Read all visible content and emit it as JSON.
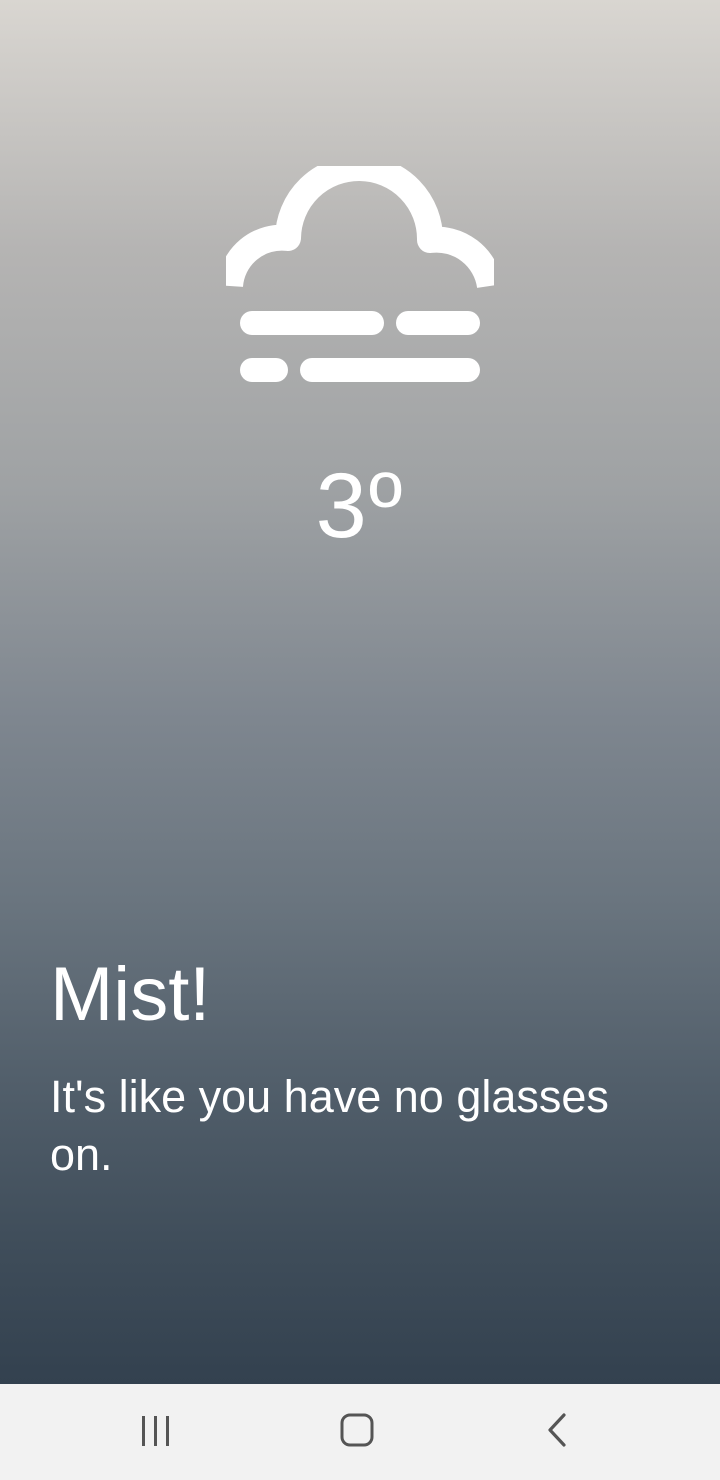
{
  "weather": {
    "condition_icon": "mist-icon",
    "temperature": "3º",
    "headline": "Mist!",
    "message": "It's like you have no glasses on.",
    "gradient_top": "#d9d6d1",
    "gradient_bottom": "#33414f"
  },
  "navigation_bar": {
    "buttons": [
      {
        "name": "recents",
        "icon": "recents-icon"
      },
      {
        "name": "home",
        "icon": "home-icon"
      },
      {
        "name": "back",
        "icon": "back-icon"
      }
    ],
    "background": "#f2f2f2",
    "icon_color": "#555555"
  }
}
